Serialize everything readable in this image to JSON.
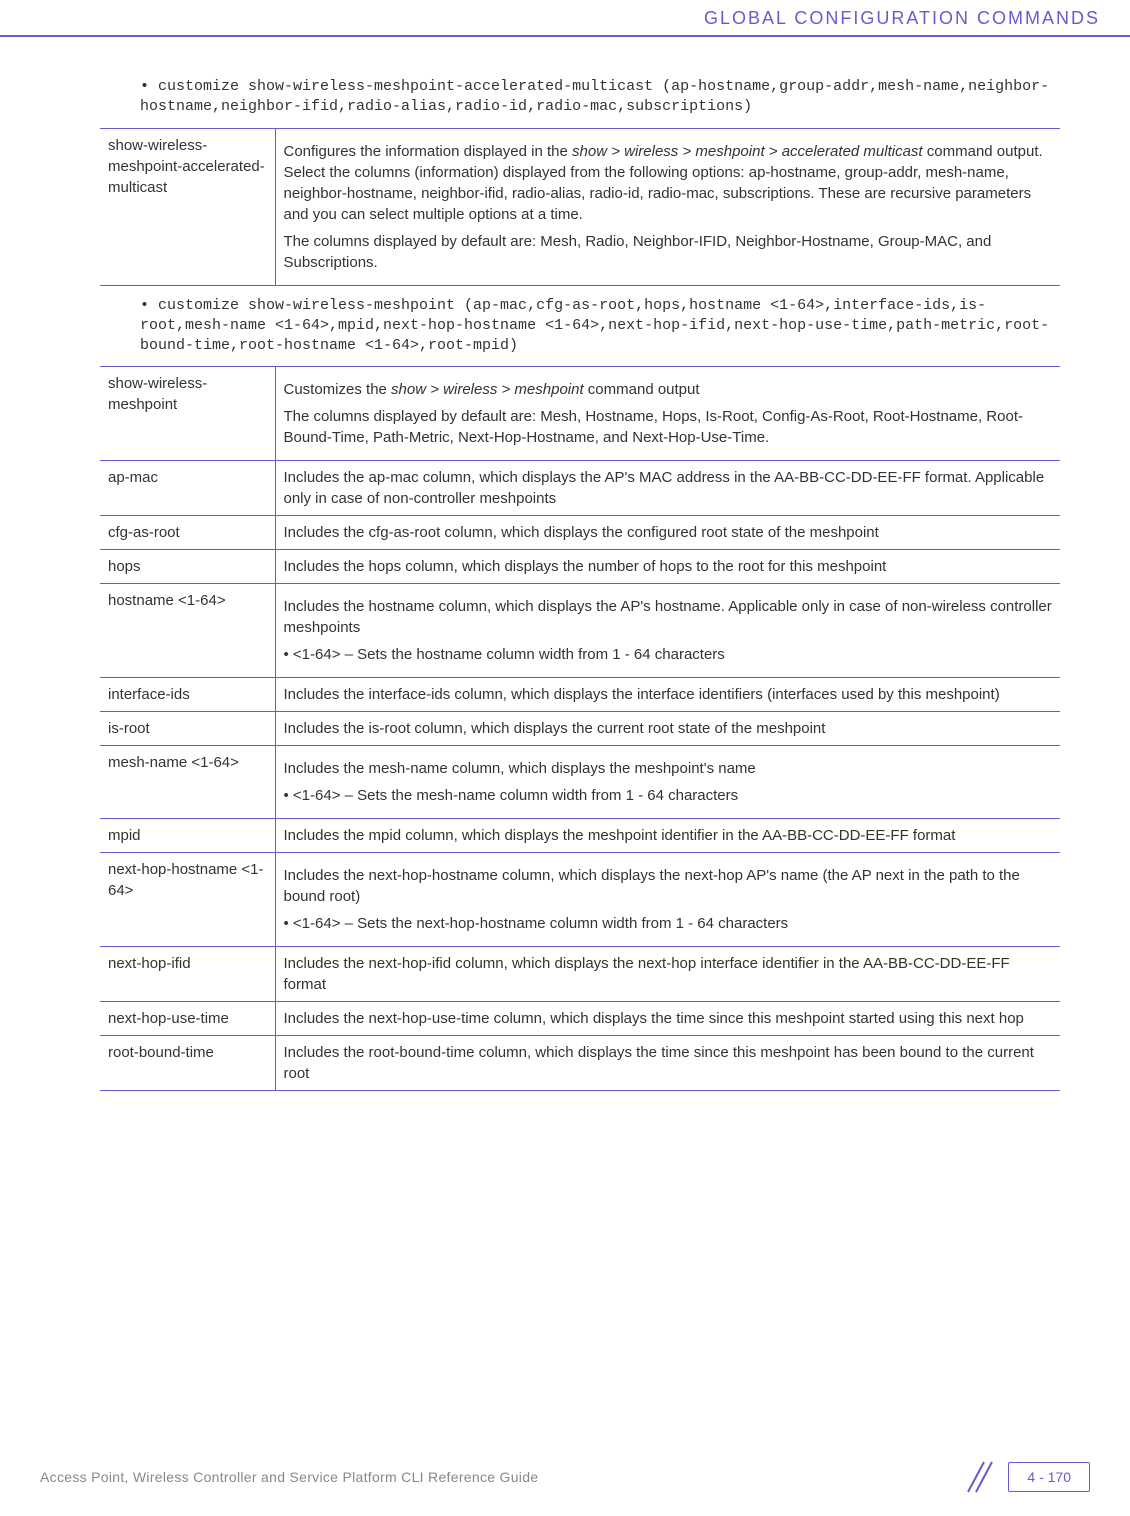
{
  "header": {
    "title": "GLOBAL CONFIGURATION COMMANDS"
  },
  "bullet1": "• customize show-wireless-meshpoint-accelerated-multicast (ap-hostname,group-addr,mesh-name,neighbor-hostname,neighbor-ifid,radio-alias,radio-id,radio-mac,subscriptions)",
  "table1": {
    "rows": [
      {
        "left": "show-wireless-meshpoint-accelerated-multicast",
        "right_p1_pre": "Configures the information displayed in the ",
        "right_p1_italic": "show > wireless > meshpoint > accelerated multicast",
        "right_p1_post": " command output. Select the columns (information) displayed from the following options: ap-hostname, group-addr, mesh-name, neighbor-hostname, neighbor-ifid, radio-alias, radio-id, radio-mac, subscriptions. These are recursive parameters and you can select multiple options at a time.",
        "right_p2": "The columns displayed by default are: Mesh, Radio, Neighbor-IFID, Neighbor-Hostname, Group-MAC, and Subscriptions."
      }
    ]
  },
  "bullet2": "• customize show-wireless-meshpoint (ap-mac,cfg-as-root,hops,hostname <1-64>,interface-ids,is-root,mesh-name <1-64>,mpid,next-hop-hostname <1-64>,next-hop-ifid,next-hop-use-time,path-metric,root-bound-time,root-hostname <1-64>,root-mpid)",
  "table2": {
    "rows": [
      {
        "left": "show-wireless-meshpoint",
        "r_p1_pre": "Customizes the ",
        "r_p1_italic": "show > wireless > meshpoint",
        "r_p1_post": " command output",
        "r_p2": "The columns displayed by default are: Mesh, Hostname, Hops, Is-Root, Config-As-Root, Root-Hostname, Root-Bound-Time, Path-Metric, Next-Hop-Hostname, and Next-Hop-Use-Time."
      },
      {
        "left": "ap-mac",
        "r_p1": "Includes the ap-mac column, which displays the AP's MAC address in the AA-BB-CC-DD-EE-FF format. Applicable only in case of non-controller meshpoints"
      },
      {
        "left": "cfg-as-root",
        "r_p1": "Includes the cfg-as-root column, which displays the configured root state of the meshpoint"
      },
      {
        "left": "hops",
        "r_p1": "Includes the hops column, which displays the number of hops to the root for this meshpoint"
      },
      {
        "left": "hostname <1-64>",
        "r_p1": "Includes the hostname column, which displays the AP's hostname. Applicable only in case of non-wireless controller meshpoints",
        "r_b1": "• <1-64> – Sets the hostname column width from 1 - 64 characters"
      },
      {
        "left": "interface-ids",
        "r_p1": "Includes the interface-ids column, which displays the interface identifiers (interfaces used by this meshpoint)"
      },
      {
        "left": "is-root",
        "r_p1": "Includes the is-root column, which displays the current root state of the meshpoint"
      },
      {
        "left": "mesh-name <1-64>",
        "r_p1": "Includes the mesh-name column, which displays the meshpoint's name",
        "r_b1": "• <1-64> – Sets the mesh-name column width from 1 - 64 characters"
      },
      {
        "left": "mpid",
        "r_p1": "Includes the mpid column, which displays the meshpoint identifier in the AA-BB-CC-DD-EE-FF format"
      },
      {
        "left": "next-hop-hostname <1-64>",
        "r_p1": "Includes the next-hop-hostname column, which displays the next-hop AP's name (the AP next in the path to the bound root)",
        "r_b1": "• <1-64> – Sets the next-hop-hostname column width from 1 - 64 characters"
      },
      {
        "left": "next-hop-ifid",
        "r_p1": "Includes the next-hop-ifid column, which displays the next-hop interface identifier in the AA-BB-CC-DD-EE-FF format"
      },
      {
        "left": "next-hop-use-time",
        "r_p1": "Includes the next-hop-use-time column, which displays the time since this meshpoint started using this next hop"
      },
      {
        "left": "root-bound-time",
        "r_p1": "Includes the root-bound-time column, which displays the time since this meshpoint has been bound to the current root"
      }
    ]
  },
  "footer": {
    "left": "Access Point, Wireless Controller and Service Platform CLI Reference Guide",
    "page": "4 - 170"
  }
}
